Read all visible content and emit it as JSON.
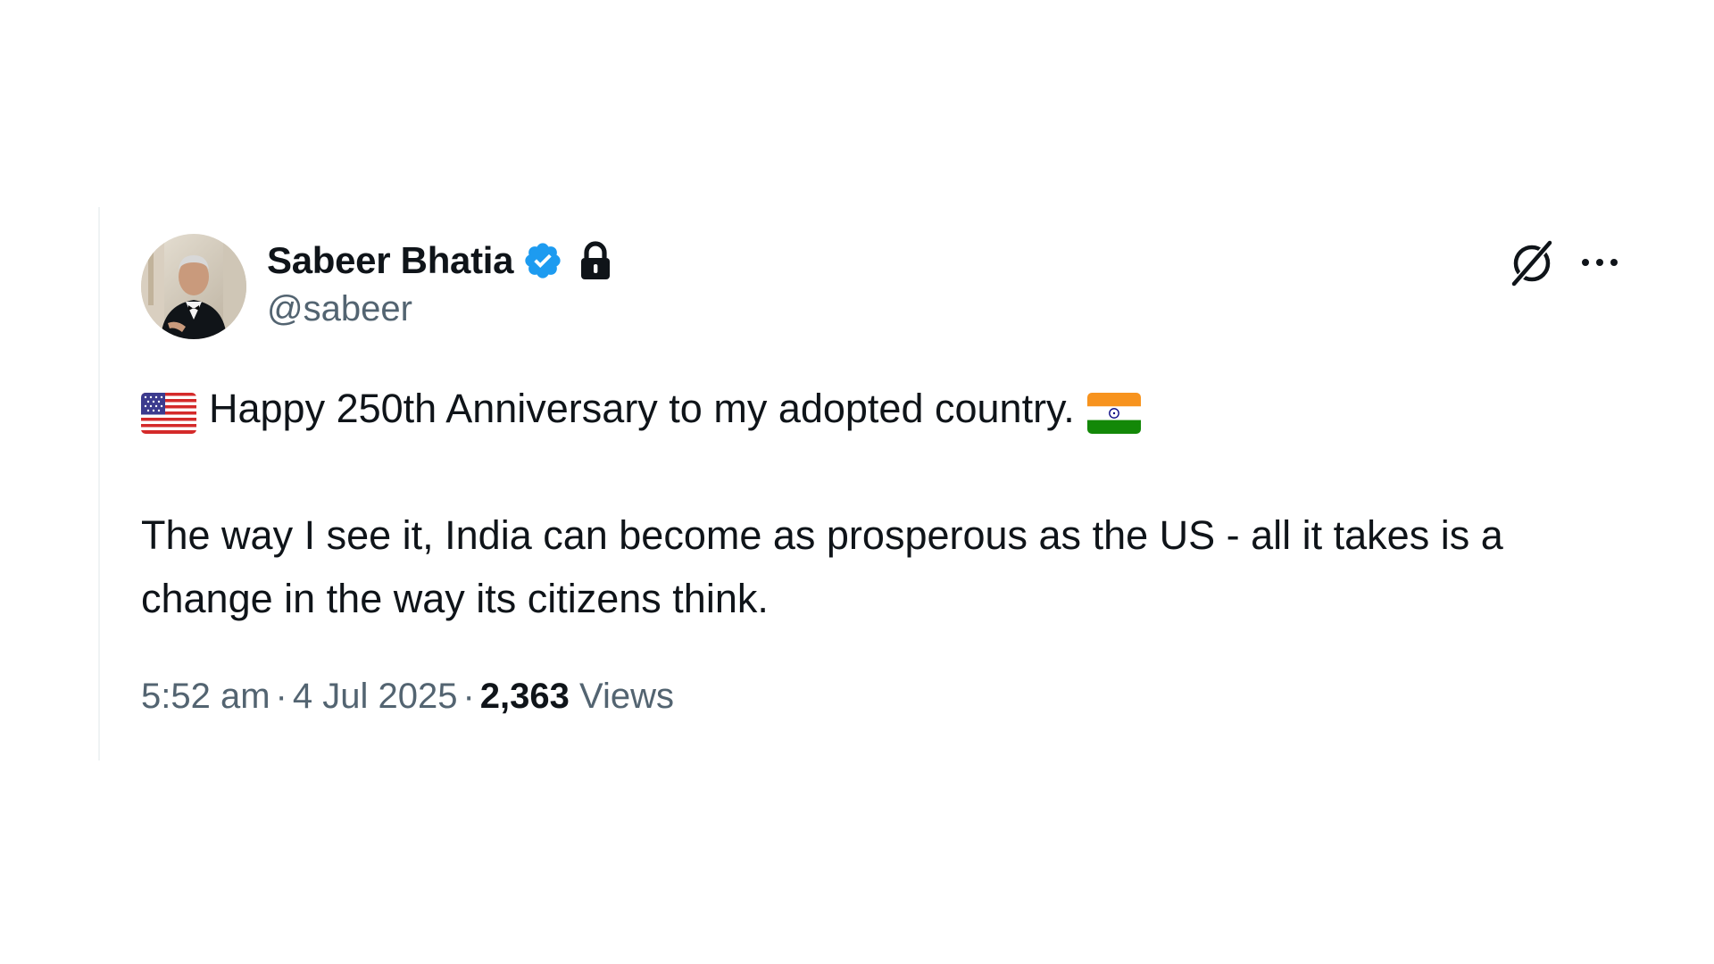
{
  "author": {
    "display_name": "Sabeer Bhatia",
    "handle": "@sabeer",
    "verified_icon": "verified-badge-icon",
    "lock_icon": "lock-icon",
    "avatar": "avatar"
  },
  "actions": {
    "grok_icon": "grok-icon",
    "more_icon": "more-options-icon"
  },
  "tweet": {
    "line1_flag_left": "us-flag-icon",
    "line1_text": "Happy 250th Anniversary to my adopted country.",
    "line1_flag_right": "india-flag-icon",
    "paragraph2": "The way I see it, India can become as prosperous as the US - all it takes is a change in the way its citizens think."
  },
  "meta": {
    "time": "5:52 am",
    "separator": "·",
    "date": "4 Jul 2025",
    "views_count": "2,363",
    "views_label": "Views"
  },
  "colors": {
    "text_primary": "#0f1419",
    "text_secondary": "#536471",
    "verified_blue": "#1d9bf0"
  }
}
